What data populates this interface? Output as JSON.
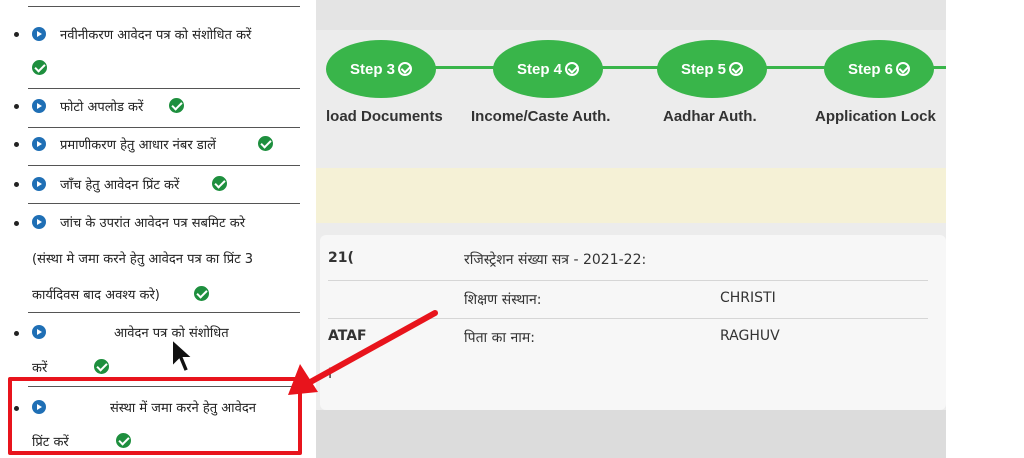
{
  "steps": [
    {
      "label": "Step 3",
      "caption": "load Documents"
    },
    {
      "label": "Step 4",
      "caption": "Income/Caste Auth."
    },
    {
      "label": "Step 5",
      "caption": "Aadhar Auth."
    },
    {
      "label": "Step 6",
      "caption": "Application Lock"
    }
  ],
  "info": {
    "left_fragment_1": "21(",
    "left_fragment_2": "ATAF",
    "left_fragment_3": "I",
    "reg_label": "रजिस्ट्रेशन संख्या सत्र - 2021-22:",
    "institution_label": "शिक्षण संस्थान:",
    "institution_value": "CHRISTI",
    "father_label": "पिता का नाम:",
    "father_value": "RAGHUV"
  },
  "sidebar": {
    "items": [
      {
        "text": "नवीनीकरण आवेदन पत्र को संशोधित करें"
      },
      {
        "text": "फोटो अपलोड करें"
      },
      {
        "text": "प्रमाणीकरण हेतु आधार नंबर डालें"
      },
      {
        "text": "जाँच हेतु आवेदन प्रिंट करें"
      },
      {
        "text_line1": "जांच के उपरांत आवेदन पत्र सबमिट करे",
        "text_line2": "(संस्था मे जमा करने हेतु आवेदन पत्र का प्रिंट 3",
        "text_line3": "कार्यदिवस बाद अवश्य करे)"
      },
      {
        "text_line1": "आवेदन पत्र को संशोधित",
        "text_line2": "करें"
      },
      {
        "text_line1": "संस्था में जमा करने हेतु आवेदन",
        "text_line2": "प्रिंट करें"
      }
    ]
  },
  "colors": {
    "step_green": "#39b54a",
    "check_green": "#1e8f3e",
    "highlight_red": "#e8141c",
    "arrow_blue": "#1f6fb5"
  },
  "icons": [
    "arrow-circle-icon",
    "check-circle-icon",
    "mouse-cursor-icon",
    "red-pointer-arrow"
  ]
}
